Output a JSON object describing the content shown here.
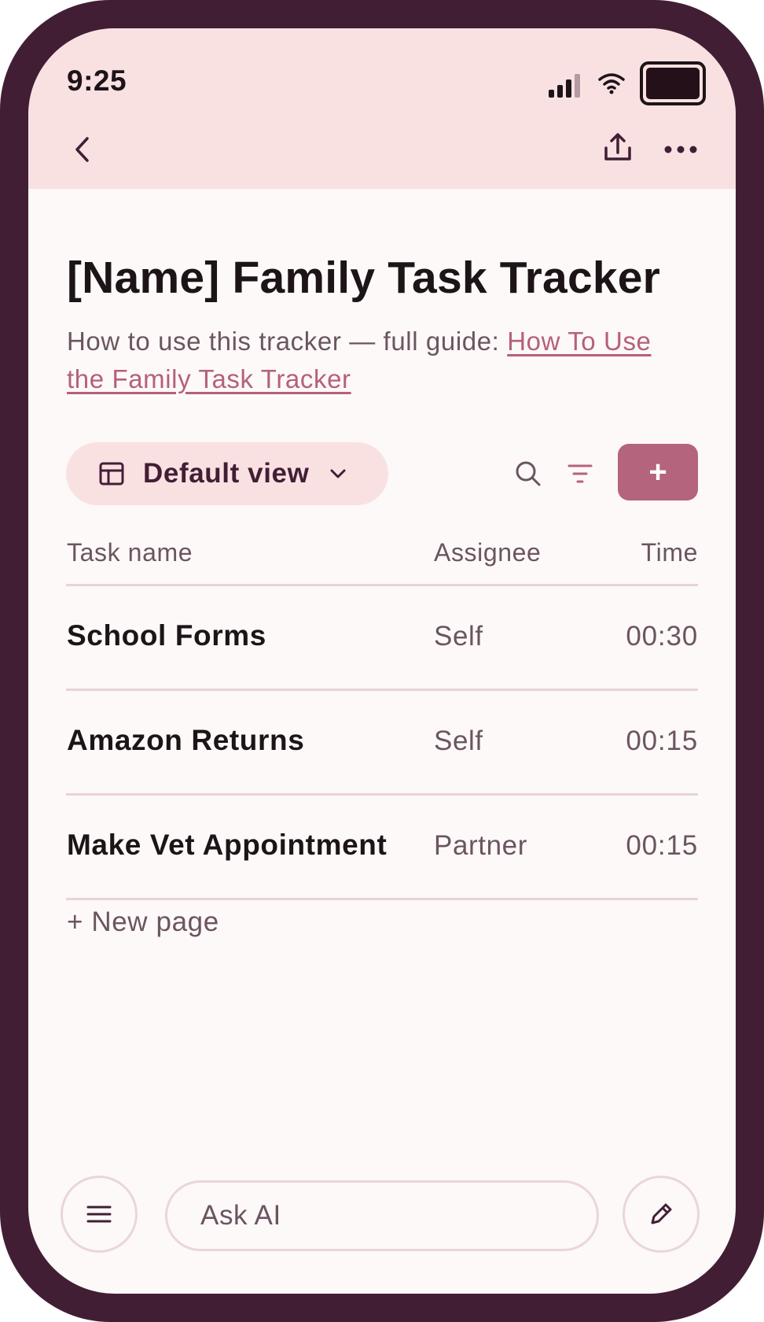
{
  "status_bar": {
    "time": "9:25"
  },
  "header": {
    "icons": [
      "back-chevron-icon",
      "share-icon",
      "more-icon"
    ]
  },
  "page": {
    "title": "[Name] Family Task Tracker",
    "subtitle_prefix": "How to use this tracker — full guide: ",
    "guide_link": "How To Use the Family Task Tracker"
  },
  "toolbar": {
    "view_label": "Default view",
    "add_label": "+"
  },
  "table": {
    "columns": [
      "Task name",
      "Assignee",
      "Time"
    ],
    "rows": [
      {
        "name": "School Forms",
        "assignee": "Self",
        "time": "00:30"
      },
      {
        "name": "Amazon Returns",
        "assignee": "Self",
        "time": "00:15"
      },
      {
        "name": "Make Vet Appointment",
        "assignee": "Partner",
        "time": "00:15"
      }
    ],
    "new_page": "+ New page"
  },
  "bottom_bar": {
    "ask_placeholder": "Ask AI"
  },
  "colors": {
    "frame": "#421e35",
    "header_bg": "#f9e1e2",
    "accent": "#b4647d",
    "link": "#b5607b",
    "text": "#1d1418",
    "muted": "#6b5560"
  }
}
